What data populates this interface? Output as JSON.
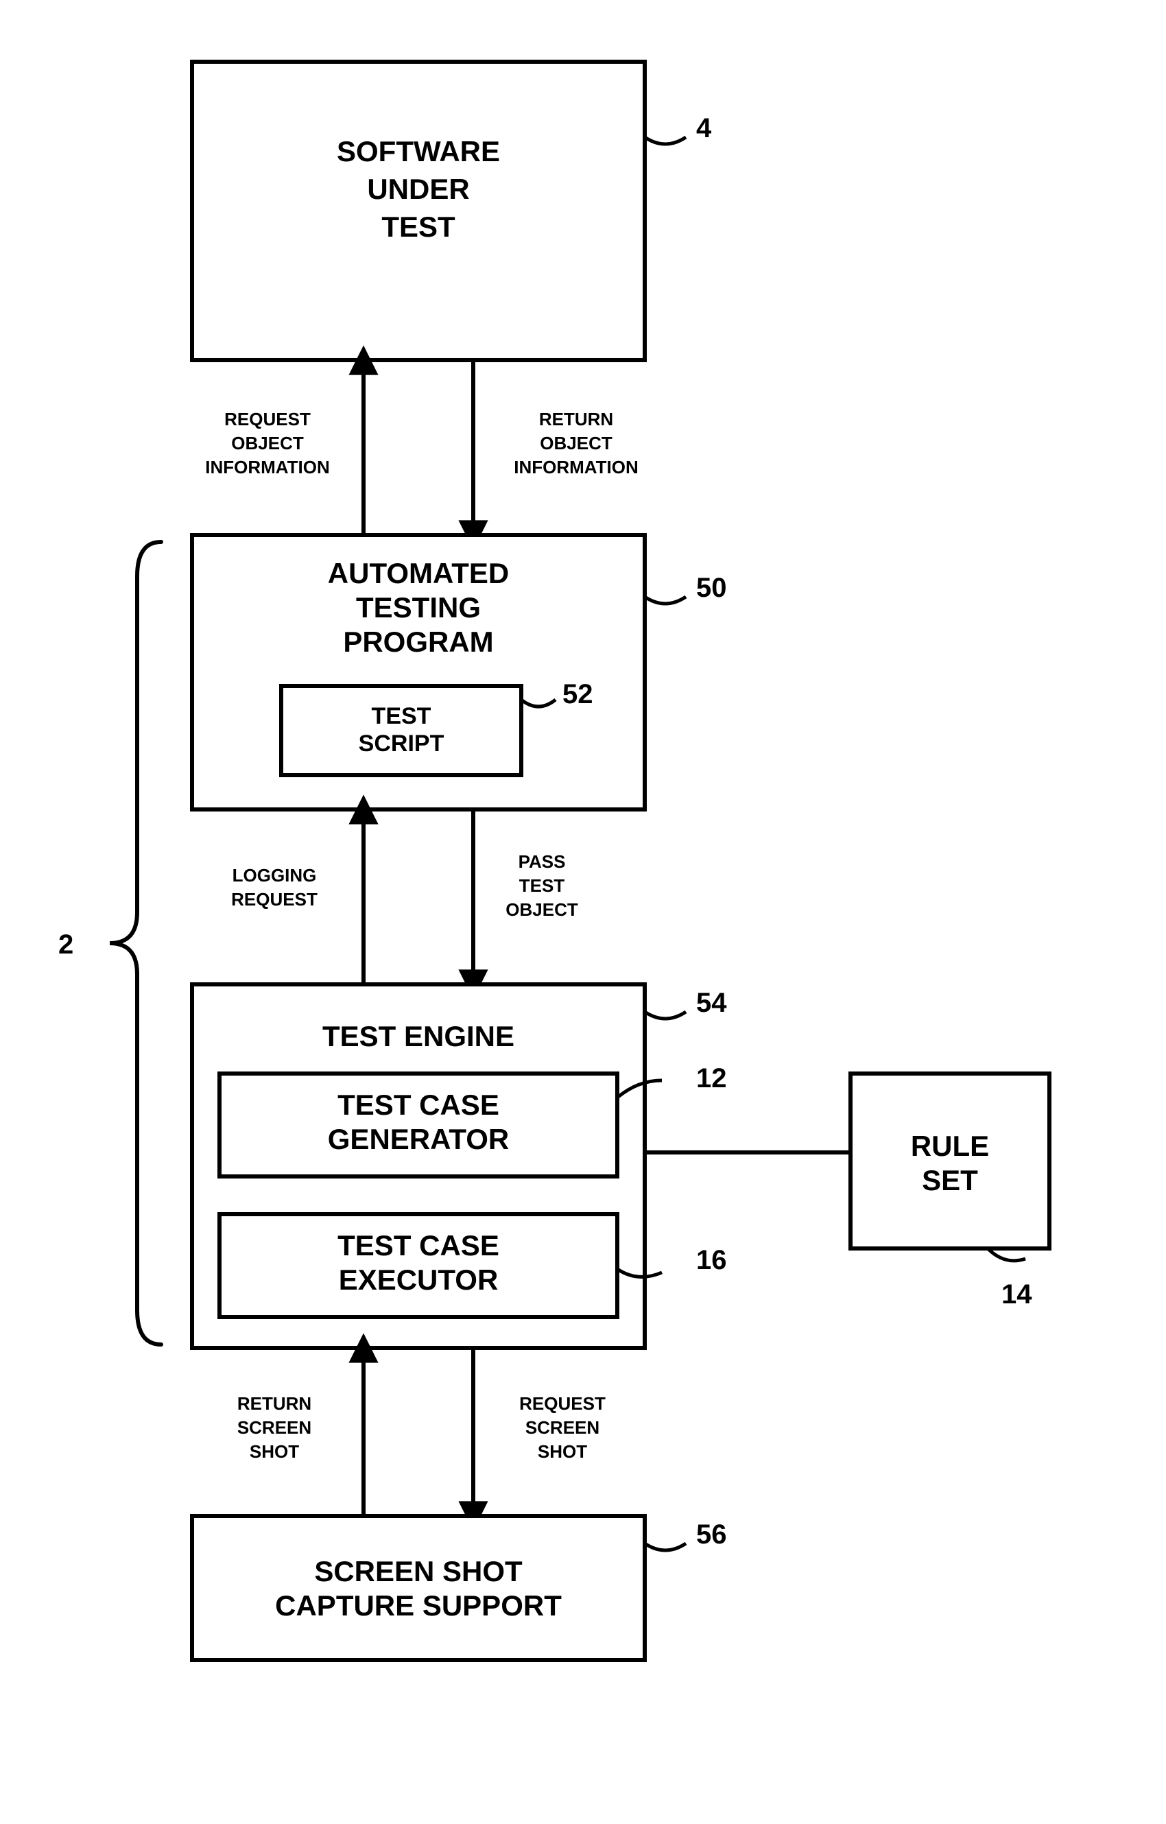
{
  "boxes": {
    "sut": {
      "l1": "SOFTWARE",
      "l2": "UNDER",
      "l3": "TEST",
      "ref": "4"
    },
    "atp": {
      "l1": "AUTOMATED",
      "l2": "TESTING",
      "l3": "PROGRAM",
      "ref": "50"
    },
    "script": {
      "l1": "TEST",
      "l2": "SCRIPT",
      "ref": "52"
    },
    "engine": {
      "title": "TEST ENGINE",
      "ref": "54"
    },
    "tcg": {
      "l1": "TEST CASE",
      "l2": "GENERATOR",
      "ref": "12"
    },
    "tce": {
      "l1": "TEST CASE",
      "l2": "EXECUTOR",
      "ref": "16"
    },
    "rule": {
      "l1": "RULE",
      "l2": "SET",
      "ref": "14"
    },
    "ssc": {
      "l1": "SCREEN SHOT",
      "l2": "CAPTURE SUPPORT",
      "ref": "56"
    }
  },
  "edges": {
    "sut_atp_up": {
      "l1": "REQUEST",
      "l2": "OBJECT",
      "l3": "INFORMATION"
    },
    "sut_atp_down": {
      "l1": "RETURN",
      "l2": "OBJECT",
      "l3": "INFORMATION"
    },
    "atp_eng_up": {
      "l1": "LOGGING",
      "l2": "REQUEST"
    },
    "atp_eng_down": {
      "l1": "PASS",
      "l2": "TEST",
      "l3": "OBJECT"
    },
    "eng_ssc_up": {
      "l1": "RETURN",
      "l2": "SCREEN",
      "l3": "SHOT"
    },
    "eng_ssc_down": {
      "l1": "REQUEST",
      "l2": "SCREEN",
      "l3": "SHOT"
    }
  },
  "group_ref": "2"
}
